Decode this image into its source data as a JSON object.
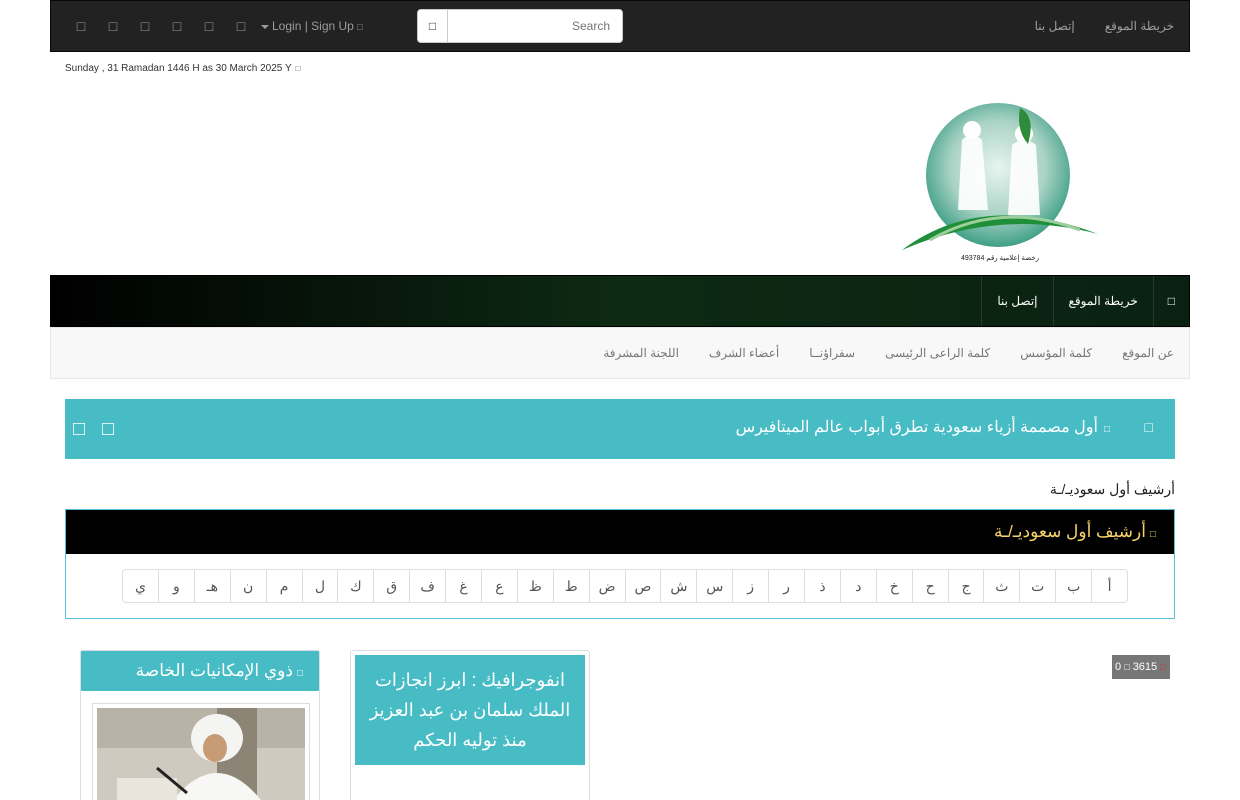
{
  "topbar": {
    "social_icons": [
      "social-icon-1",
      "social-icon-2",
      "social-icon-3",
      "social-icon-4",
      "social-icon-5",
      "social-icon-6"
    ],
    "login_label": "Login | Sign Up",
    "search_placeholder": "Search",
    "links": [
      "خريطة الموقع",
      "إتصل بنا"
    ]
  },
  "date_text": "Sunday , 31 Ramadan 1446 H as 30 March 2025 Y",
  "logo": {
    "caption": "رخصة إعلامية رقم 493784"
  },
  "mainnav": {
    "items": [
      "خريطة الموقع",
      "إتصل بنا"
    ]
  },
  "subnav": {
    "items": [
      "عن الموقع",
      "كلمة المؤسس",
      "كلمة الراعى الرئيسى",
      "سفراؤنــا",
      "أعضاء الشرف",
      "اللجنة المشرفة"
    ]
  },
  "ticker": {
    "headline": "أول مصممة أزياء سعودية تطرق أبواب عالم الميتافيرس"
  },
  "breadcrumb": "أرشيف أول سعوديـ/ـة",
  "archive": {
    "title": "أرشيف أول سعوديـ/ـة",
    "letters": [
      "أ",
      "ب",
      "ت",
      "ث",
      "ج",
      "ح",
      "خ",
      "د",
      "ذ",
      "ر",
      "ز",
      "س",
      "ش",
      "ص",
      "ض",
      "ط",
      "ظ",
      "ع",
      "غ",
      "ف",
      "ق",
      "ك",
      "ل",
      "م",
      "ن",
      "هـ",
      "و",
      "ي"
    ]
  },
  "stats": {
    "views": "3615",
    "comments": "0"
  },
  "card_infographic": {
    "title": "انفوجرافيك : ابرز انجازات الملك سلمان بن عبد العزيز منذ توليه الحكم"
  },
  "card_special": {
    "title": "ذوي الإمكانيات الخاصة"
  },
  "colors": {
    "topbar": "#222222",
    "accent": "#47bcc5",
    "nav_green": "#0d2a14",
    "gold": "#f7d46b"
  }
}
